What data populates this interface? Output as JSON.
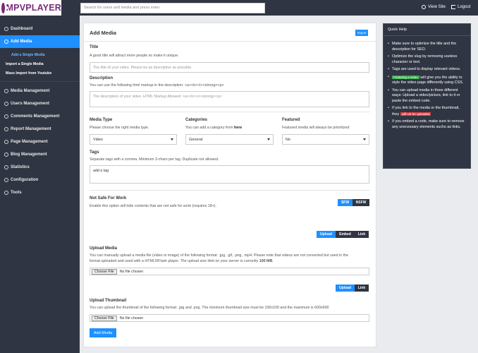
{
  "topbar": {
    "logo_text": "MPVPLAYER",
    "search_placeholder": "Search for users and media and press enter.",
    "view_site": "View Site",
    "logout": "Logout"
  },
  "sidebar": {
    "items": [
      {
        "label": "Dashboard",
        "icon": "dashboard-icon"
      },
      {
        "label": "Add Media",
        "icon": "plus-circle-icon"
      },
      {
        "label": "Media Management",
        "icon": "media-icon"
      },
      {
        "label": "Users Management",
        "icon": "user-icon"
      },
      {
        "label": "Comments Management",
        "icon": "comment-icon"
      },
      {
        "label": "Report Management",
        "icon": "report-icon"
      },
      {
        "label": "Page Management",
        "icon": "page-icon"
      },
      {
        "label": "Blog Management",
        "icon": "blog-icon"
      },
      {
        "label": "Statistics",
        "icon": "stats-icon"
      },
      {
        "label": "Configuration",
        "icon": "gear-icon"
      },
      {
        "label": "Tools",
        "icon": "wrench-icon"
      }
    ],
    "sub_items": [
      {
        "label": "Add a Single Media"
      },
      {
        "label": "Import a Single Media"
      },
      {
        "label": "Mass Import from Youtube"
      }
    ]
  },
  "main": {
    "title": "Add Media",
    "import_label": "Import",
    "title_field": {
      "label": "Title",
      "hint": "A good title will attract more people so make it unique.",
      "placeholder": "The title of your video. Please be as descriptive as possible."
    },
    "description_field": {
      "label": "Description",
      "hint": "You can use the following html markup in the description: <a><b><i><strong><p>",
      "placeholder": "The description of your video. HTML Markup Allowed: <a><b><i><strong><p>"
    },
    "media_type": {
      "label": "Media Type",
      "hint": "Please choose the right media type.",
      "value": "Video"
    },
    "categories": {
      "label": "Categories",
      "hint_prefix": "You can add a category from",
      "hint_link": "here",
      "value": "General"
    },
    "featured": {
      "label": "Featured",
      "hint": "Featured media will always be prioritized",
      "value": "No"
    },
    "tags": {
      "label": "Tags",
      "hint": "Separate tags with a comma. Minimum 3-chars per tag. Duplicate not allowed.",
      "placeholder": "add a tag"
    },
    "nsfw": {
      "label": "Not Safe For Work",
      "hint": "Enable this option will hide contents that are not safe for work (requires 18+).",
      "sfw": "SFW",
      "nsfw": "NSFW"
    },
    "media_tabs": [
      "Upload",
      "Embed",
      "Link"
    ],
    "upload_media": {
      "label": "Upload Media",
      "hint_line1": "You can manually upload a media file (video or image) of the following format: .jpg, .gif, .png, .mp4. Please note that videos are not converted but used in the",
      "hint_line2_prefix": "format uploaded and used with a HTML5/Flash player. The upload size limit on your server is currently",
      "hint_limit": "100 MB",
      "choose_file": "Choose File",
      "no_file": "No file chosen"
    },
    "thumb_tabs": [
      "Upload",
      "Link"
    ],
    "upload_thumbnail": {
      "label": "Upload Thumbnail",
      "hint": "You can upload the thumbnail of the following format: .jpg and .png. The minimum thumbnail size must be 100x100 and the maximum is 600x600",
      "choose_file": "Choose File",
      "no_file": "No file chosen"
    },
    "submit_label": "Add Media"
  },
  "help": {
    "title": "Quick Help",
    "tip1": "Make sure to optimize the title and the description for SEO.",
    "tip2": "Optimize the slug by removing useless character or text.",
    "tip3": "Tags are used to display relevant videos.",
    "tip4_tag": "Featuring a video",
    "tip4_text": "will give you the ability to style the video page differently using CSS.",
    "tip5": "You can upload media in three different ways: Upload a video/picture, link to it or paste the embed code.",
    "tip6_text": "If you link to the media or the thumbnail, they",
    "tip6_tag": "will not be uploaded",
    "tip7": "If you embed a code, make sure to remove any unecessary elements suchs as links."
  }
}
